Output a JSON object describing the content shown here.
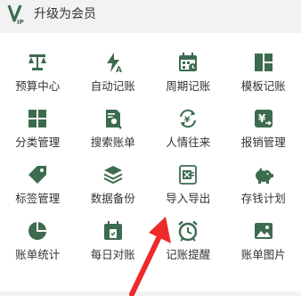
{
  "header": {
    "title": "升级为会员",
    "logo_icon": "vip-logo-icon"
  },
  "accent_color": "#3d6b4f",
  "grid": [
    {
      "label": "预算中心",
      "icon": "scale-icon"
    },
    {
      "label": "自动记账",
      "icon": "auto-bookkeeping-icon"
    },
    {
      "label": "周期记账",
      "icon": "recurring-calendar-icon"
    },
    {
      "label": "模板记账",
      "icon": "template-icon"
    },
    {
      "label": "分类管理",
      "icon": "category-grid-icon"
    },
    {
      "label": "搜索账单",
      "icon": "search-document-icon"
    },
    {
      "label": "人情往来",
      "icon": "money-exchange-icon"
    },
    {
      "label": "报销管理",
      "icon": "reimbursement-icon"
    },
    {
      "label": "标签管理",
      "icon": "tag-icon"
    },
    {
      "label": "数据备份",
      "icon": "layers-icon"
    },
    {
      "label": "导入导出",
      "icon": "excel-import-export-icon"
    },
    {
      "label": "存钱计划",
      "icon": "piggy-bank-icon"
    },
    {
      "label": "账单统计",
      "icon": "pie-chart-icon"
    },
    {
      "label": "每日对账",
      "icon": "daily-check-calendar-icon"
    },
    {
      "label": "记账提醒",
      "icon": "alarm-clock-icon"
    },
    {
      "label": "账单图片",
      "icon": "picture-icon"
    }
  ]
}
